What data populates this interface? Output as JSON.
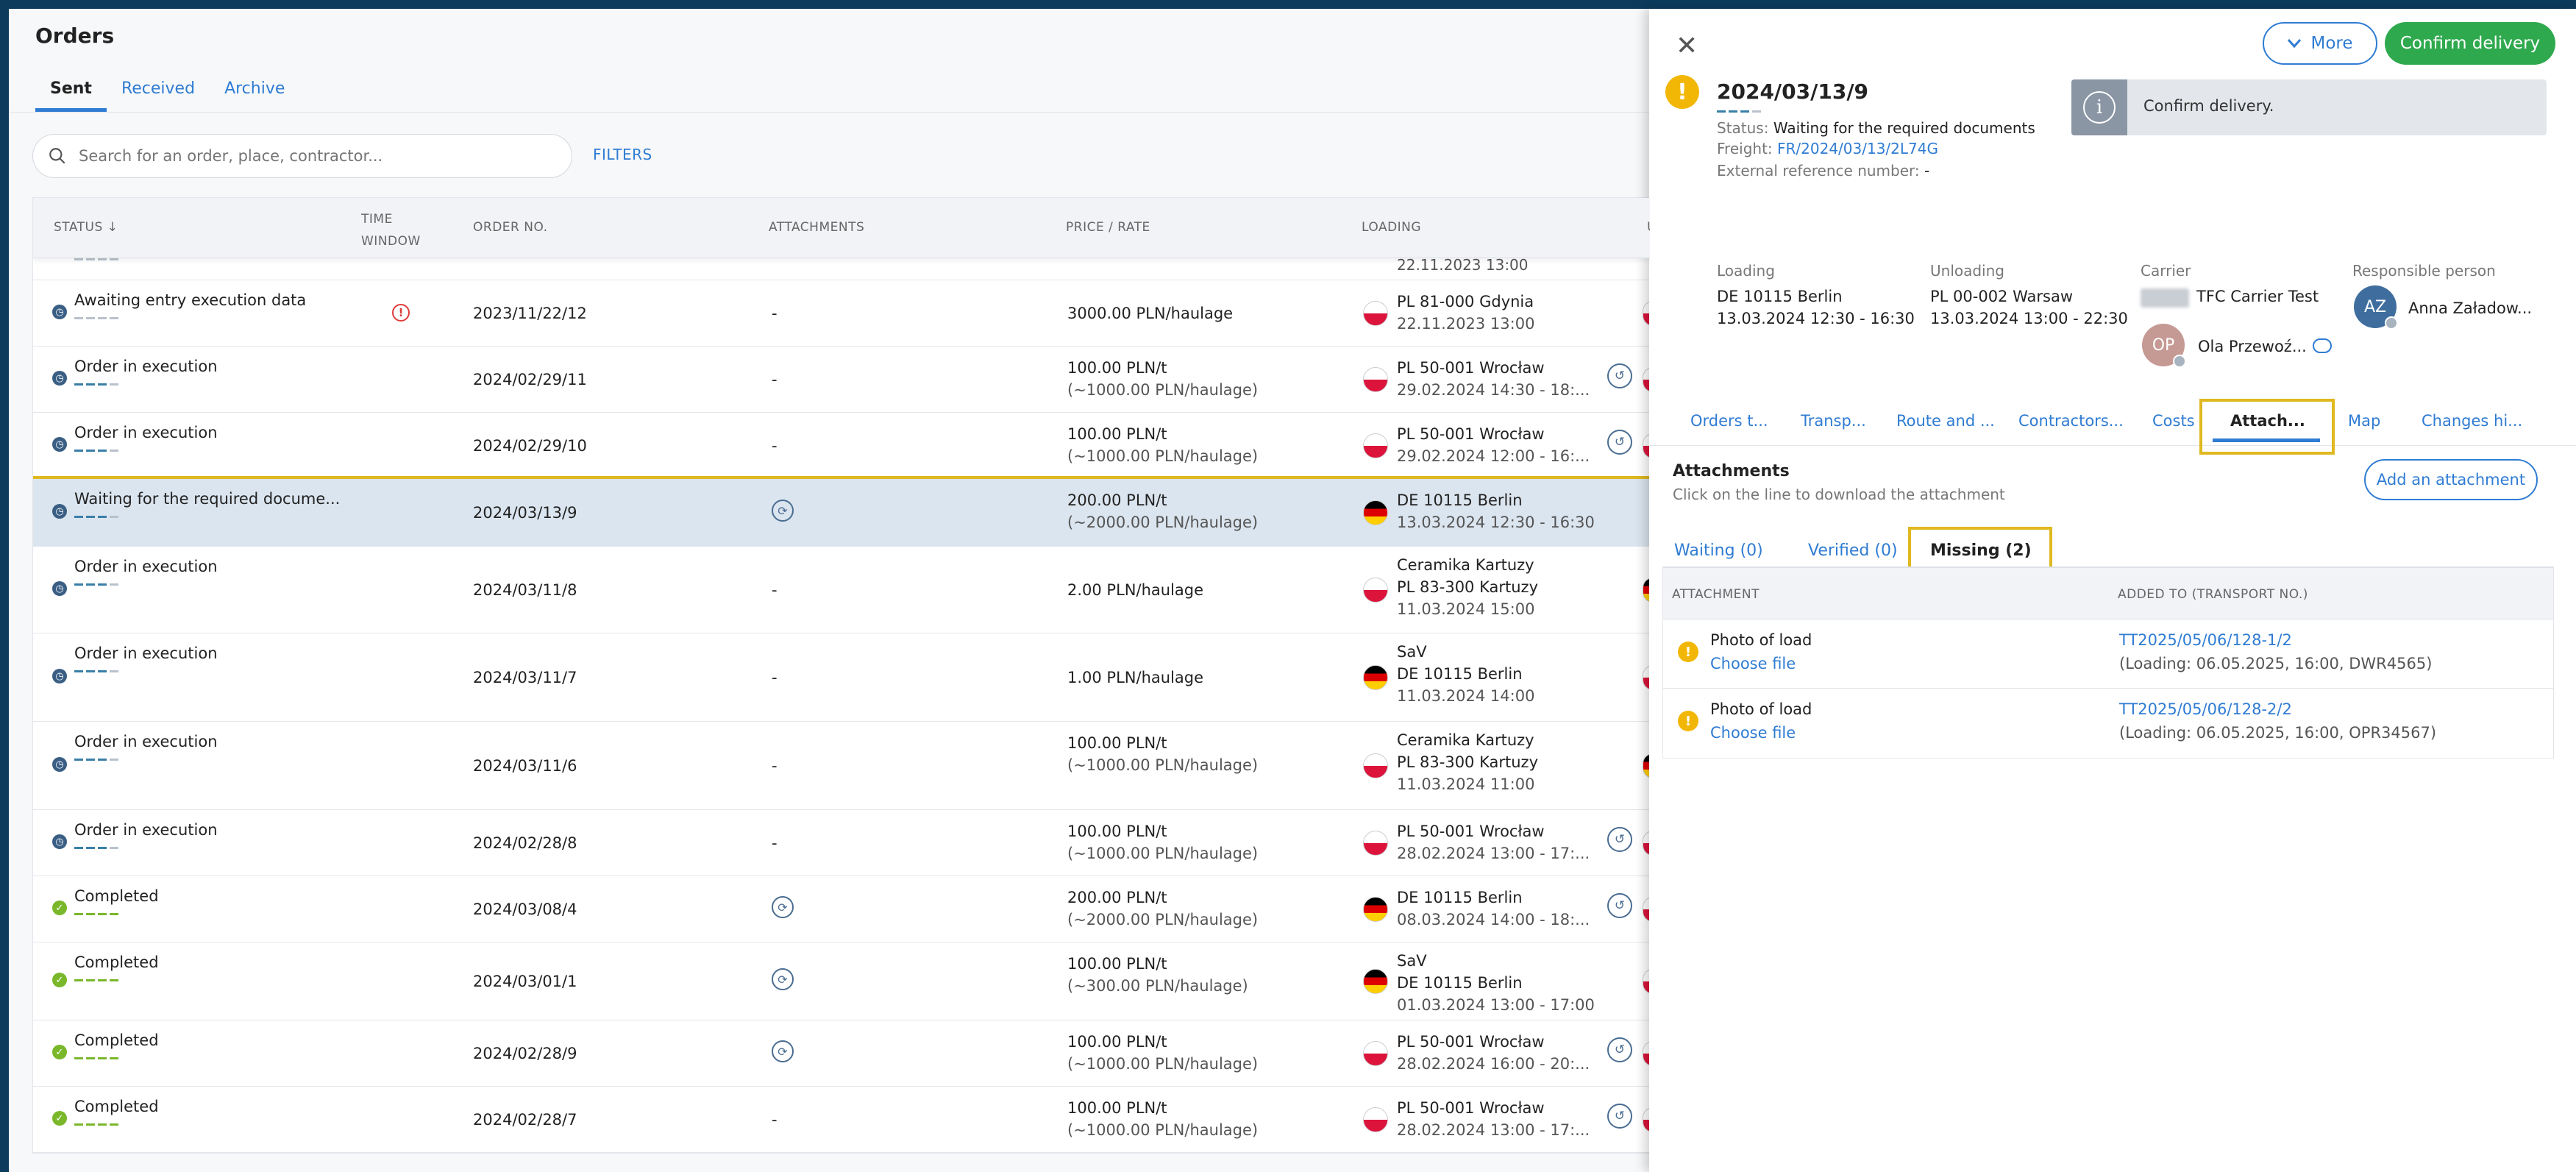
{
  "orders": {
    "title": "Orders",
    "tabs": [
      "Sent",
      "Received",
      "Archive"
    ],
    "search_placeholder": "Search for an order, place, contractor...",
    "filters_label": "FILTERS",
    "columns": {
      "status": "STATUS ↓",
      "time_window_1": "TIME",
      "time_window_2": "WINDOW",
      "order_no": "ORDER NO.",
      "attachments": "ATTACHMENTS",
      "price": "PRICE / RATE",
      "loading": "LOADING",
      "unloading_partial": "U"
    },
    "partial_row": {
      "loading_time": "22.11.2023 13:00"
    },
    "rows": [
      {
        "status": "Awaiting entry execution data",
        "order_no": "2023/11/22/12",
        "attachments": "-",
        "price": "3000.00 PLN/haulage",
        "price_sub": "",
        "loading_company": "",
        "loading_place": "PL 81-000 Gdynia",
        "loading_time": "22.11.2023 13:00",
        "flag": "pl"
      },
      {
        "status": "Order in execution",
        "order_no": "2024/02/29/11",
        "attachments": "-",
        "price": "100.00 PLN/t",
        "price_sub": "(~1000.00 PLN/haulage)",
        "loading_company": "",
        "loading_place": "PL 50-001 Wrocław",
        "loading_time": "29.02.2024 14:30 - 18:...",
        "flag": "pl"
      },
      {
        "status": "Order in execution",
        "order_no": "2024/02/29/10",
        "attachments": "-",
        "price": "100.00 PLN/t",
        "price_sub": "(~1000.00 PLN/haulage)",
        "loading_company": "",
        "loading_place": "PL 50-001 Wrocław",
        "loading_time": "29.02.2024 12:00 - 16:...",
        "flag": "pl"
      },
      {
        "status": "Waiting for the required docume...",
        "order_no": "2024/03/13/9",
        "attachments": "",
        "price": "200.00 PLN/t",
        "price_sub": "(~2000.00 PLN/haulage)",
        "loading_company": "",
        "loading_place": "DE 10115 Berlin",
        "loading_time": "13.03.2024 12:30 - 16:30",
        "flag": "de"
      },
      {
        "status": "Order in execution",
        "order_no": "2024/03/11/8",
        "attachments": "-",
        "price": "2.00 PLN/haulage",
        "price_sub": "",
        "loading_company": "Ceramika Kartuzy",
        "loading_place": "PL 83-300 Kartuzy",
        "loading_time": "11.03.2024 15:00",
        "flag": "pl"
      },
      {
        "status": "Order in execution",
        "order_no": "2024/03/11/7",
        "attachments": "-",
        "price": "1.00 PLN/haulage",
        "price_sub": "",
        "loading_company": "SaV",
        "loading_place": "DE 10115 Berlin",
        "loading_time": "11.03.2024 14:00",
        "flag": "de"
      },
      {
        "status": "Order in execution",
        "order_no": "2024/03/11/6",
        "attachments": "-",
        "price": "100.00 PLN/t",
        "price_sub": "(~1000.00 PLN/haulage)",
        "loading_company": "Ceramika Kartuzy",
        "loading_place": "PL 83-300 Kartuzy",
        "loading_time": "11.03.2024 11:00",
        "flag": "pl"
      },
      {
        "status": "Order in execution",
        "order_no": "2024/02/28/8",
        "attachments": "-",
        "price": "100.00 PLN/t",
        "price_sub": "(~1000.00 PLN/haulage)",
        "loading_company": "",
        "loading_place": "PL 50-001 Wrocław",
        "loading_time": "28.02.2024 13:00 - 17:...",
        "flag": "pl"
      },
      {
        "status": "Completed",
        "order_no": "2024/03/08/4",
        "attachments": "",
        "price": "200.00 PLN/t",
        "price_sub": "(~2000.00 PLN/haulage)",
        "loading_company": "",
        "loading_place": "DE 10115 Berlin",
        "loading_time": "08.03.2024 14:00 - 18:...",
        "flag": "de"
      },
      {
        "status": "Completed",
        "order_no": "2024/03/01/1",
        "attachments": "",
        "price": "100.00 PLN/t",
        "price_sub": "(~300.00 PLN/haulage)",
        "loading_company": "SaV",
        "loading_place": "DE 10115 Berlin",
        "loading_time": "01.03.2024 13:00 - 17:00",
        "flag": "de"
      },
      {
        "status": "Completed",
        "order_no": "2024/02/28/9",
        "attachments": "",
        "price": "100.00 PLN/t",
        "price_sub": "(~1000.00 PLN/haulage)",
        "loading_company": "",
        "loading_place": "PL 50-001 Wrocław",
        "loading_time": "28.02.2024 16:00 - 20:...",
        "flag": "pl"
      },
      {
        "status": "Completed",
        "order_no": "2024/02/28/7",
        "attachments": "-",
        "price": "100.00 PLN/t",
        "price_sub": "(~1000.00 PLN/haulage)",
        "loading_company": "",
        "loading_place": "PL 50-001 Wrocław",
        "loading_time": "28.02.2024 13:00 - 17:...",
        "flag": "pl"
      }
    ]
  },
  "panel": {
    "more_label": "More",
    "confirm_label": "Confirm delivery",
    "order_no": "2024/03/13/9",
    "status_label": "Status:",
    "status_value": "Waiting for the required documents",
    "freight_label": "Freight:",
    "freight_value": "FR/2024/03/13/2L74G",
    "extref_label": "External reference number:",
    "extref_value": "-",
    "info_message": "Confirm delivery.",
    "loading_label": "Loading",
    "loading_place": "DE 10115 Berlin",
    "loading_time": "13.03.2024 12:30 - 16:30",
    "unloading_label": "Unloading",
    "unloading_place": "PL 00-002 Warsaw",
    "unloading_time": "13.03.2024 13:00 - 22:30",
    "carrier_label": "Carrier",
    "carrier_name": "TFC Carrier Test",
    "carrier_person_initials": "OP",
    "carrier_person": "Ola Przewoź...",
    "responsible_label": "Responsible person",
    "responsible_initials": "AZ",
    "responsible_name": "Anna Załadow...",
    "tabs": [
      "Orders t...",
      "Transp...",
      "Route and ...",
      "Contractors...",
      "Costs",
      "Attach...",
      "Map",
      "Changes hi..."
    ],
    "attachments_title": "Attachments",
    "attachments_hint": "Click on the line to download the attachment",
    "add_attachment": "Add an attachment",
    "subtabs": [
      "Waiting (0)",
      "Verified (0)",
      "Missing (2)"
    ],
    "att_columns": {
      "attachment": "ATTACHMENT",
      "added_to": "ADDED TO (TRANSPORT NO.)"
    },
    "att_rows": [
      {
        "name": "Photo of load",
        "choose": "Choose file",
        "transport": "TT2025/05/06/128-1/2",
        "detail": "(Loading: 06.05.2025, 16:00, DWR4565)"
      },
      {
        "name": "Photo of load",
        "choose": "Choose file",
        "transport": "TT2025/05/06/128-2/2",
        "detail": "(Loading: 06.05.2025, 16:00, OPR34567)"
      }
    ]
  },
  "colors": {
    "accent": "#2f7cd3",
    "confirm": "#2fa94e",
    "warning": "#f2b705",
    "highlight": "#e0b81f",
    "completed": "#7ab72b"
  }
}
